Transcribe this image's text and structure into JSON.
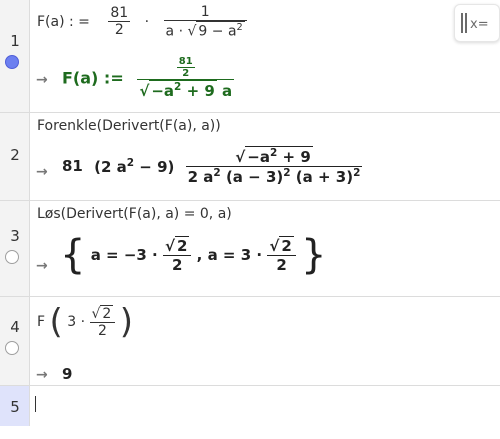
{
  "rows": [
    {
      "num": "1",
      "input": {
        "prefix": "F(a) : =",
        "frac1_num": "81",
        "frac1_den": "2",
        "dot": "·",
        "frac2_num": "1",
        "frac2_den_a": "a ·",
        "frac2_den_rad": "9 − a",
        "frac2_den_exp": "2"
      },
      "output": {
        "lhs": "F(a) :=",
        "inner_num": "81",
        "inner_den": "2",
        "den_rad": "−a",
        "den_exp": "2",
        "den_rad_tail": "+ 9",
        "den_tail": "a"
      }
    },
    {
      "num": "2",
      "input": {
        "text": "Forenkle(Derivert(F(a),  a))"
      },
      "output": {
        "coef": "81",
        "factor": "(2 a",
        "factor_exp": "2",
        "factor_tail": "− 9)",
        "num_rad": "−a",
        "num_exp": "2",
        "num_tail": "+ 9",
        "den_a": "2 a",
        "den_a_exp": "2",
        "den_m": "(a − 3)",
        "den_m_exp": "2",
        "den_p": "(a + 3)",
        "den_p_exp": "2"
      }
    },
    {
      "num": "3",
      "input": {
        "text": "Løs(Derivert(F(a),  a)   =   0,  a)"
      },
      "output": {
        "open": "{",
        "eq1": "a = −3 ·",
        "rad1": "2",
        "den1": "2",
        "sep": ", a = 3 ·",
        "rad2": "2",
        "den2": "2",
        "close": "}"
      }
    },
    {
      "num": "4",
      "input": {
        "fn": "F",
        "lp": "(",
        "coef": "3 ·",
        "rad": "2",
        "den": "2",
        "rp": ")"
      },
      "output": {
        "value": "9"
      }
    },
    {
      "num": "5",
      "input": {
        "text": ""
      }
    }
  ],
  "arrow": "→",
  "keyboard_button": {
    "label": "x="
  },
  "colors": {
    "marble_on": "#6c7ff0",
    "output_definition": "#1e6b1e",
    "gutter": "#f3f3f3"
  }
}
